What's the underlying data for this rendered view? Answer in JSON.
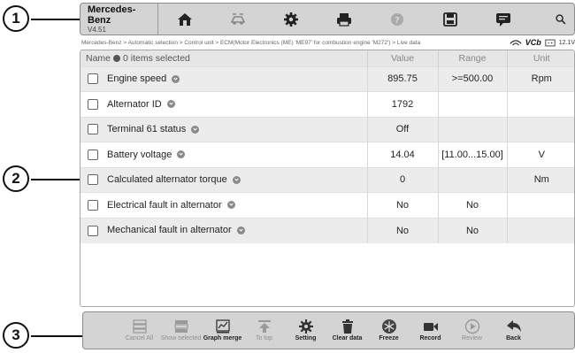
{
  "callouts": [
    "1",
    "2",
    "3"
  ],
  "topbar": {
    "brand": "Mercedes-Benz",
    "version": "V4.51",
    "icons": [
      "home-icon",
      "vehicle-swap-icon",
      "settings-icon",
      "print-icon",
      "help-icon",
      "save-icon",
      "chat-icon"
    ],
    "search_icon": "search-icon"
  },
  "breadcrumb": {
    "path": "Mercedes-Benz > Automatic selection > Control unit > ECM(Motor Electronics (ME) 'ME97' for combustion engine 'M272') > Live data",
    "vcb": "VCb",
    "voltage": "12.1V"
  },
  "table": {
    "columns": {
      "name": "Name",
      "selected": "0 items selected",
      "value": "Value",
      "range": "Range",
      "unit": "Unit"
    },
    "rows": [
      {
        "name": "Engine speed",
        "value": "895.75",
        "range": ">=500.00",
        "unit": "Rpm"
      },
      {
        "name": "Alternator ID",
        "value": "1792",
        "range": "",
        "unit": ""
      },
      {
        "name": "Terminal 61 status",
        "value": "Off",
        "range": "",
        "unit": ""
      },
      {
        "name": "Battery voltage",
        "value": "14.04",
        "range": "[11.00...15.00]",
        "unit": "V"
      },
      {
        "name": "Calculated alternator torque",
        "value": "0",
        "range": "",
        "unit": "Nm"
      },
      {
        "name": "Electrical fault in alternator",
        "value": "No",
        "range": "No",
        "unit": ""
      },
      {
        "name": "Mechanical fault in alternator",
        "value": "No",
        "range": "No",
        "unit": ""
      }
    ]
  },
  "bottombar": {
    "items": [
      {
        "label": "Cancel All",
        "enabled": false
      },
      {
        "label": "Show selected",
        "enabled": false
      },
      {
        "label": "Graph merge",
        "enabled": true
      },
      {
        "label": "To top",
        "enabled": false
      },
      {
        "label": "Setting",
        "enabled": true
      },
      {
        "label": "Clear data",
        "enabled": true
      },
      {
        "label": "Freeze",
        "enabled": true
      },
      {
        "label": "Record",
        "enabled": true
      },
      {
        "label": "Review",
        "enabled": false
      },
      {
        "label": "Back",
        "enabled": true
      }
    ]
  }
}
